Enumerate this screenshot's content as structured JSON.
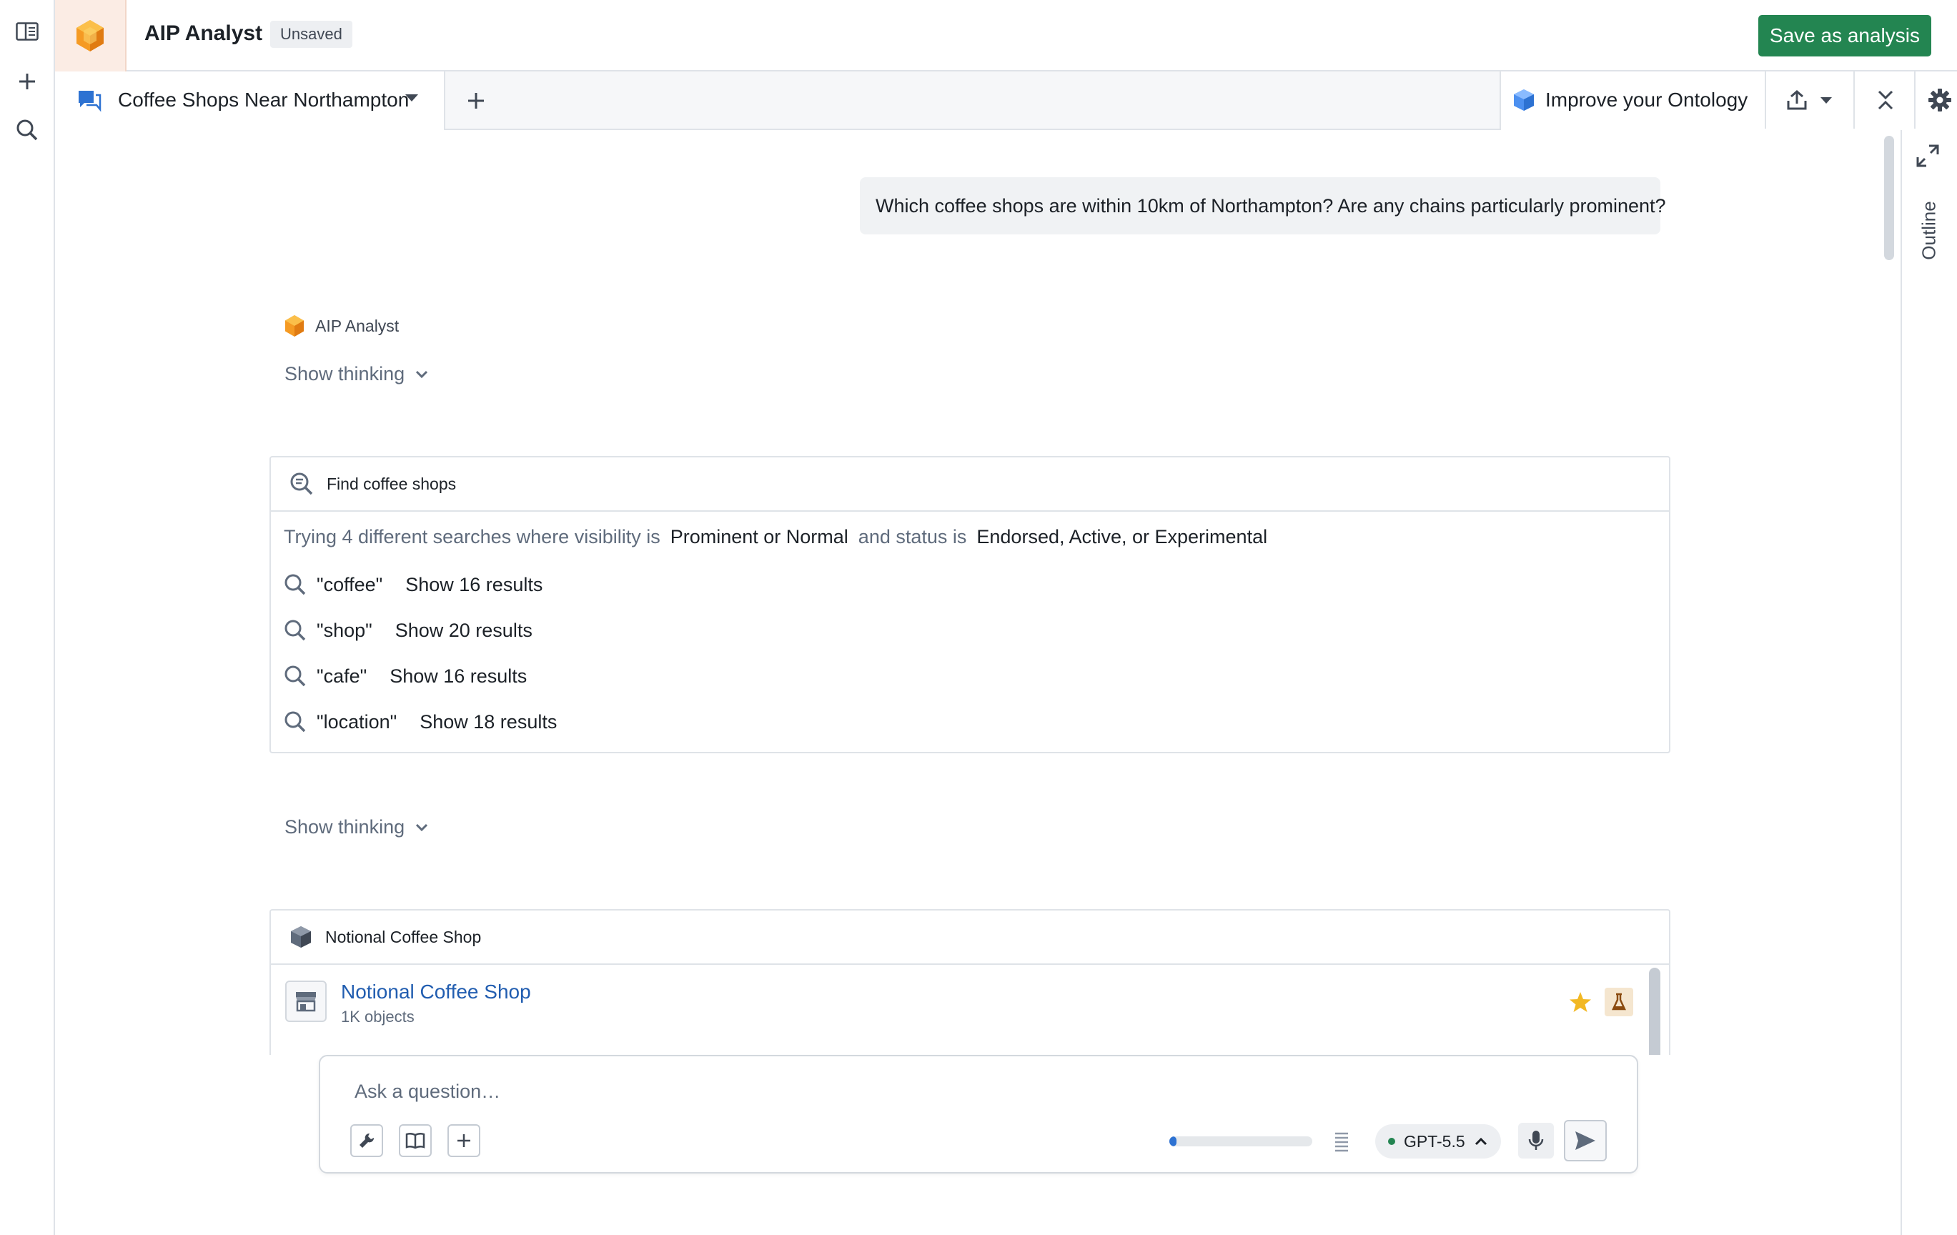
{
  "header": {
    "app_title": "AIP Analyst",
    "status_badge": "Unsaved",
    "save_label": "Save as analysis"
  },
  "left_rail": {
    "icons": [
      "panel-toggle-icon",
      "plus-icon",
      "search-icon"
    ]
  },
  "tabs": {
    "active_label": "Coffee Shops Near Northampton",
    "improve_label": "Improve your Ontology"
  },
  "outline": {
    "label": "Outline"
  },
  "conversation": {
    "user_message": "Which coffee shops are within 10km of Northampton? Are any chains particularly prominent?",
    "assistant_name": "AIP Analyst",
    "show_thinking_label": "Show thinking",
    "search_card": {
      "title": "Find coffee shops",
      "desc_prefix": "Trying 4 different searches where visibility is",
      "visibility": "Prominent or Normal",
      "desc_mid": "and status is",
      "status": "Endorsed, Active, or Experimental",
      "searches": [
        {
          "term": "\"coffee\"",
          "result": "Show 16 results"
        },
        {
          "term": "\"shop\"",
          "result": "Show 20 results"
        },
        {
          "term": "\"cafe\"",
          "result": "Show 16 results"
        },
        {
          "term": "\"location\"",
          "result": "Show 18 results"
        }
      ]
    },
    "object_card": {
      "title": "Notional Coffee Shop",
      "object_name": "Notional Coffee Shop",
      "object_count": "1K objects"
    }
  },
  "composer": {
    "placeholder": "Ask a question…",
    "model": "GPT-5.5",
    "context_usage_fraction": 0.05
  },
  "colors": {
    "primary_green": "#238551",
    "link_blue": "#215db0",
    "progress_blue": "#2d72d2",
    "star": "#f2b824"
  }
}
